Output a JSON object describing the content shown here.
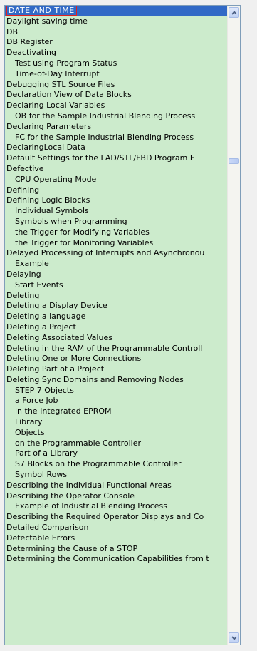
{
  "index": {
    "selected_index": 0,
    "items": [
      {
        "label": "DATE  AND  TIME",
        "level": 0
      },
      {
        "label": "Daylight saving time",
        "level": 0
      },
      {
        "label": "DB",
        "level": 0
      },
      {
        "label": "DB Register",
        "level": 0
      },
      {
        "label": "Deactivating",
        "level": 0
      },
      {
        "label": "Test using Program Status",
        "level": 1
      },
      {
        "label": "Time-of-Day Interrupt",
        "level": 1
      },
      {
        "label": "Debugging STL Source Files",
        "level": 0
      },
      {
        "label": "Declaration View of Data Blocks",
        "level": 0
      },
      {
        "label": "Declaring Local Variables",
        "level": 0
      },
      {
        "label": "OB for the Sample Industrial Blending Process",
        "level": 1
      },
      {
        "label": "Declaring Parameters",
        "level": 0
      },
      {
        "label": "FC for the Sample Industrial Blending Process",
        "level": 1
      },
      {
        "label": "DeclaringLocal Data",
        "level": 0
      },
      {
        "label": "Default Settings for the LAD/STL/FBD Program E",
        "level": 0
      },
      {
        "label": "Defective",
        "level": 0
      },
      {
        "label": "CPU Operating Mode",
        "level": 1
      },
      {
        "label": "Defining",
        "level": 0
      },
      {
        "label": "Defining Logic Blocks",
        "level": 0
      },
      {
        "label": "Individual Symbols",
        "level": 1
      },
      {
        "label": "Symbols when Programming",
        "level": 1
      },
      {
        "label": "the Trigger for Modifying Variables",
        "level": 1
      },
      {
        "label": "the Trigger for Monitoring Variables",
        "level": 1
      },
      {
        "label": "Delayed Processing of Interrupts and Asynchronou",
        "level": 0
      },
      {
        "label": "Example",
        "level": 1
      },
      {
        "label": "Delaying",
        "level": 0
      },
      {
        "label": "Start Events",
        "level": 1
      },
      {
        "label": "Deleting",
        "level": 0
      },
      {
        "label": "Deleting a Display Device",
        "level": 0
      },
      {
        "label": "Deleting a language",
        "level": 0
      },
      {
        "label": "Deleting a Project",
        "level": 0
      },
      {
        "label": "Deleting Associated Values",
        "level": 0
      },
      {
        "label": "Deleting in the RAM of the Programmable Controll",
        "level": 0
      },
      {
        "label": "Deleting One or More Connections",
        "level": 0
      },
      {
        "label": "Deleting Part of a Project",
        "level": 0
      },
      {
        "label": "Deleting Sync Domains and Removing Nodes",
        "level": 0
      },
      {
        "label": "STEP 7 Objects",
        "level": 1
      },
      {
        "label": "a Force Job",
        "level": 1
      },
      {
        "label": "in the Integrated EPROM",
        "level": 1
      },
      {
        "label": "Library",
        "level": 1
      },
      {
        "label": "Objects",
        "level": 1
      },
      {
        "label": "on the Programmable Controller",
        "level": 1
      },
      {
        "label": "Part of a Library",
        "level": 1
      },
      {
        "label": "S7 Blocks on the Programmable Controller",
        "level": 1
      },
      {
        "label": "Symbol Rows",
        "level": 1
      },
      {
        "label": "Describing the Individual Functional Areas",
        "level": 0
      },
      {
        "label": "Describing the Operator Console",
        "level": 0
      },
      {
        "label": "Example of Industrial Blending Process",
        "level": 1
      },
      {
        "label": "Describing the Required Operator Displays and Co",
        "level": 0
      },
      {
        "label": "Detailed Comparison",
        "level": 0
      },
      {
        "label": "Detectable Errors",
        "level": 0
      },
      {
        "label": "Determining the Cause of a STOP",
        "level": 0
      },
      {
        "label": "Determining the Communication Capabilities from t",
        "level": 0
      }
    ]
  },
  "scrollbar": {
    "up_icon": "chevron-up-icon",
    "down_icon": "chevron-down-icon",
    "button_color": "#c0d2f4",
    "position": 0.23
  },
  "colors": {
    "list_background": "#ccebcc",
    "selection_background": "#3169c6",
    "selection_outline": "#e02020"
  }
}
